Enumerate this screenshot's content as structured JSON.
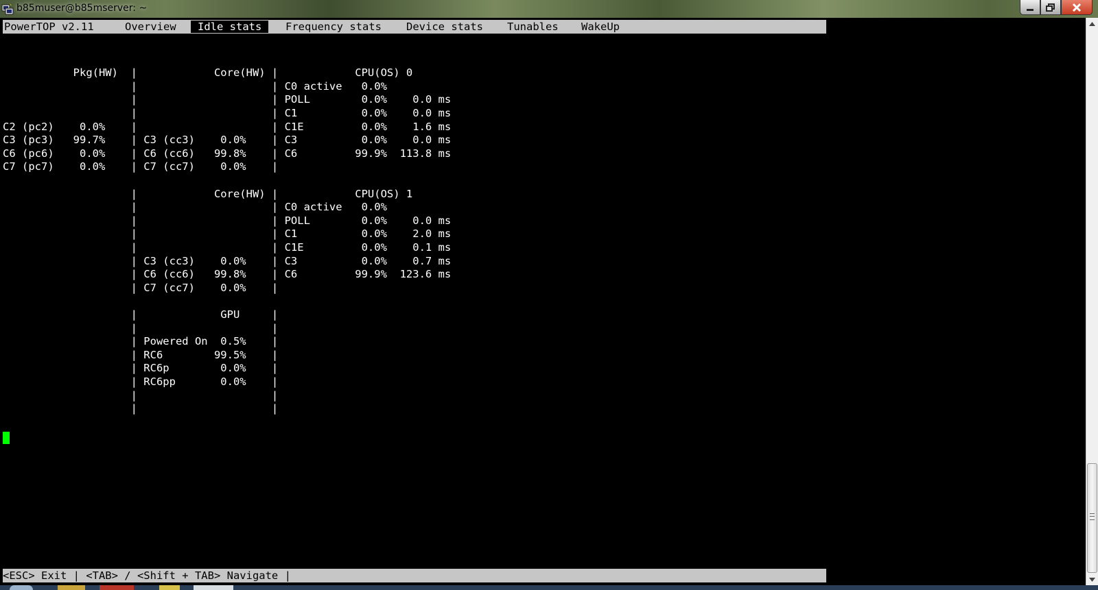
{
  "window": {
    "title": "b85muser@b85mserver: ~"
  },
  "menu": {
    "app": "PowerTOP v2.11",
    "tabs": [
      {
        "label": "Overview",
        "active": false
      },
      {
        "label": "Idle stats",
        "active": true
      },
      {
        "label": "Frequency stats",
        "active": false
      },
      {
        "label": "Device stats",
        "active": false
      },
      {
        "label": "Tunables",
        "active": false
      },
      {
        "label": "WakeUp",
        "active": false
      }
    ]
  },
  "screen_lines": [
    "",
    "",
    "           Pkg(HW)  |            Core(HW) |            CPU(OS) 0",
    "                    |                     | C0 active   0.0%",
    "                    |                     | POLL        0.0%    0.0 ms",
    "                    |                     | C1          0.0%    0.0 ms",
    "C2 (pc2)    0.0%    |                     | C1E         0.0%    1.6 ms",
    "C3 (pc3)   99.7%    | C3 (cc3)    0.0%    | C3          0.0%    0.0 ms",
    "C6 (pc6)    0.0%    | C6 (cc6)   99.8%    | C6         99.9%  113.8 ms",
    "C7 (pc7)    0.0%    | C7 (cc7)    0.0%    |",
    "",
    "                    |            Core(HW) |            CPU(OS) 1",
    "                    |                     | C0 active   0.0%",
    "                    |                     | POLL        0.0%    0.0 ms",
    "                    |                     | C1          0.0%    2.0 ms",
    "                    |                     | C1E         0.0%    0.1 ms",
    "                    | C3 (cc3)    0.0%    | C3          0.0%    0.7 ms",
    "                    | C6 (cc6)   99.8%    | C6         99.9%  123.6 ms",
    "                    | C7 (cc7)    0.0%    |",
    "",
    "                    |             GPU     |",
    "                    |                     |",
    "                    | Powered On  0.5%    |",
    "                    | RC6        99.5%    |",
    "                    | RC6p        0.0%    |",
    "                    | RC6pp       0.0%    |",
    "                    |                     |",
    "                    |                     |"
  ],
  "status": {
    "text": "<ESC> Exit | <TAB> / <Shift + TAB> Navigate |"
  },
  "colors": {
    "background": "#000000",
    "text": "#ffffff",
    "bar": "#c6c6c6",
    "cursor": "#00ff00"
  },
  "icons": {
    "window": "putty-icon",
    "minimize": "minimize-icon",
    "maximize": "restore-icon",
    "close": "close-icon"
  }
}
